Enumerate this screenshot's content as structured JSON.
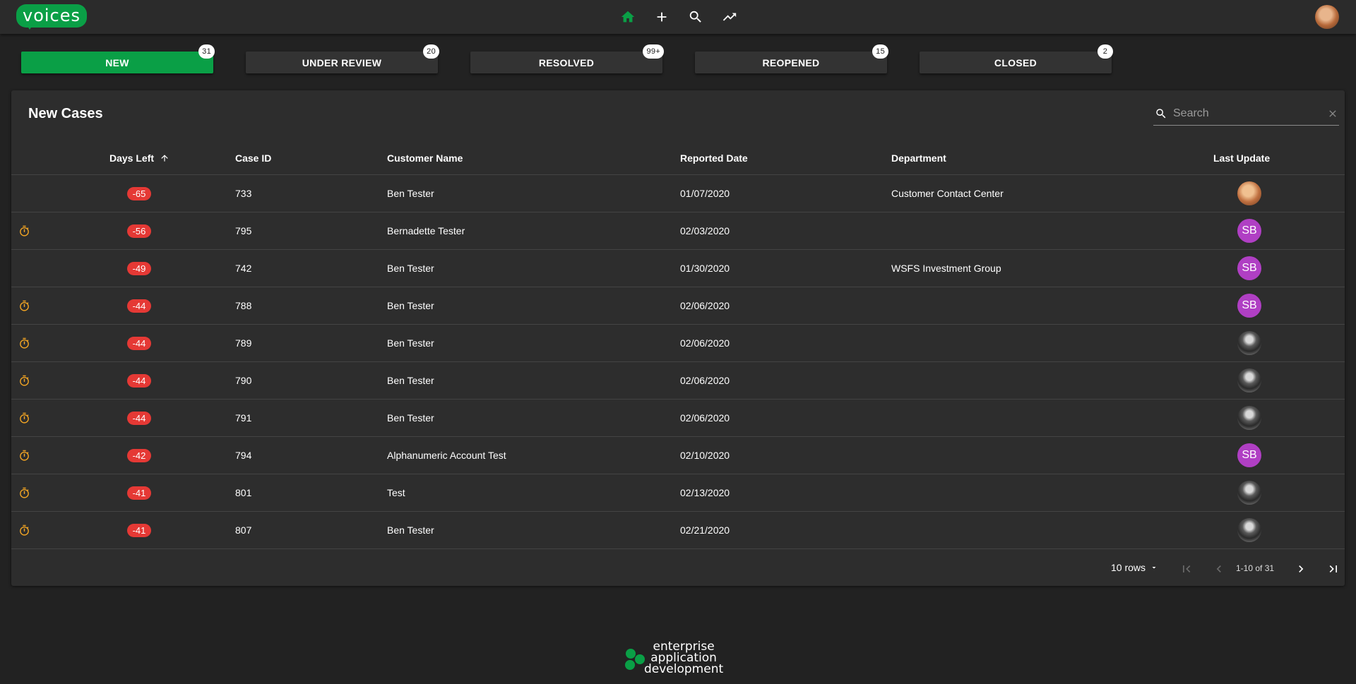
{
  "app": {
    "logo_text": "voices"
  },
  "nav": {
    "icons": [
      "home-icon",
      "add-icon",
      "search-icon",
      "trending-icon"
    ],
    "active_color": "#0a9f46"
  },
  "tabs": [
    {
      "label": "NEW",
      "count": "31",
      "active": true
    },
    {
      "label": "UNDER REVIEW",
      "count": "20",
      "active": false
    },
    {
      "label": "RESOLVED",
      "count": "99+",
      "active": false
    },
    {
      "label": "REOPENED",
      "count": "15",
      "active": false
    },
    {
      "label": "CLOSED",
      "count": "2",
      "active": false
    }
  ],
  "card": {
    "title": "New Cases",
    "search_placeholder": "Search"
  },
  "table": {
    "columns": [
      "Days Left",
      "Case ID",
      "Customer Name",
      "Reported Date",
      "Department",
      "Last Update"
    ],
    "rows": [
      {
        "timer": false,
        "days_left": "-65",
        "case_id": "733",
        "customer": "Ben Tester",
        "reported": "01/07/2020",
        "department": "Customer Contact Center",
        "last_update": {
          "type": "photo-a",
          "initials": ""
        }
      },
      {
        "timer": true,
        "days_left": "-56",
        "case_id": "795",
        "customer": "Bernadette Tester",
        "reported": "02/03/2020",
        "department": "",
        "last_update": {
          "type": "initials",
          "initials": "SB"
        }
      },
      {
        "timer": false,
        "days_left": "-49",
        "case_id": "742",
        "customer": "Ben Tester",
        "reported": "01/30/2020",
        "department": "WSFS Investment Group",
        "last_update": {
          "type": "initials",
          "initials": "SB"
        }
      },
      {
        "timer": true,
        "days_left": "-44",
        "case_id": "788",
        "customer": "Ben Tester",
        "reported": "02/06/2020",
        "department": "",
        "last_update": {
          "type": "initials",
          "initials": "SB"
        }
      },
      {
        "timer": true,
        "days_left": "-44",
        "case_id": "789",
        "customer": "Ben Tester",
        "reported": "02/06/2020",
        "department": "",
        "last_update": {
          "type": "photo-b",
          "initials": ""
        }
      },
      {
        "timer": true,
        "days_left": "-44",
        "case_id": "790",
        "customer": "Ben Tester",
        "reported": "02/06/2020",
        "department": "",
        "last_update": {
          "type": "photo-b",
          "initials": ""
        }
      },
      {
        "timer": true,
        "days_left": "-44",
        "case_id": "791",
        "customer": "Ben Tester",
        "reported": "02/06/2020",
        "department": "",
        "last_update": {
          "type": "photo-b",
          "initials": ""
        }
      },
      {
        "timer": true,
        "days_left": "-42",
        "case_id": "794",
        "customer": "Alphanumeric Account Test",
        "reported": "02/10/2020",
        "department": "",
        "last_update": {
          "type": "initials",
          "initials": "SB"
        }
      },
      {
        "timer": true,
        "days_left": "-41",
        "case_id": "801",
        "customer": "Test",
        "reported": "02/13/2020",
        "department": "",
        "last_update": {
          "type": "photo-b",
          "initials": ""
        }
      },
      {
        "timer": true,
        "days_left": "-41",
        "case_id": "807",
        "customer": "Ben Tester",
        "reported": "02/21/2020",
        "department": "",
        "last_update": {
          "type": "photo-b",
          "initials": ""
        }
      }
    ]
  },
  "pagination": {
    "rows_label": "10 rows",
    "range_label": "1-10 of 31"
  },
  "footer": {
    "brand_line1": "enterprise",
    "brand_line2": "application",
    "brand_line3": "development"
  },
  "colors": {
    "accent": "#0a9f46",
    "overdue": "#e53935",
    "timer": "#f5a623",
    "avatar_initials": "#b03fc4"
  }
}
